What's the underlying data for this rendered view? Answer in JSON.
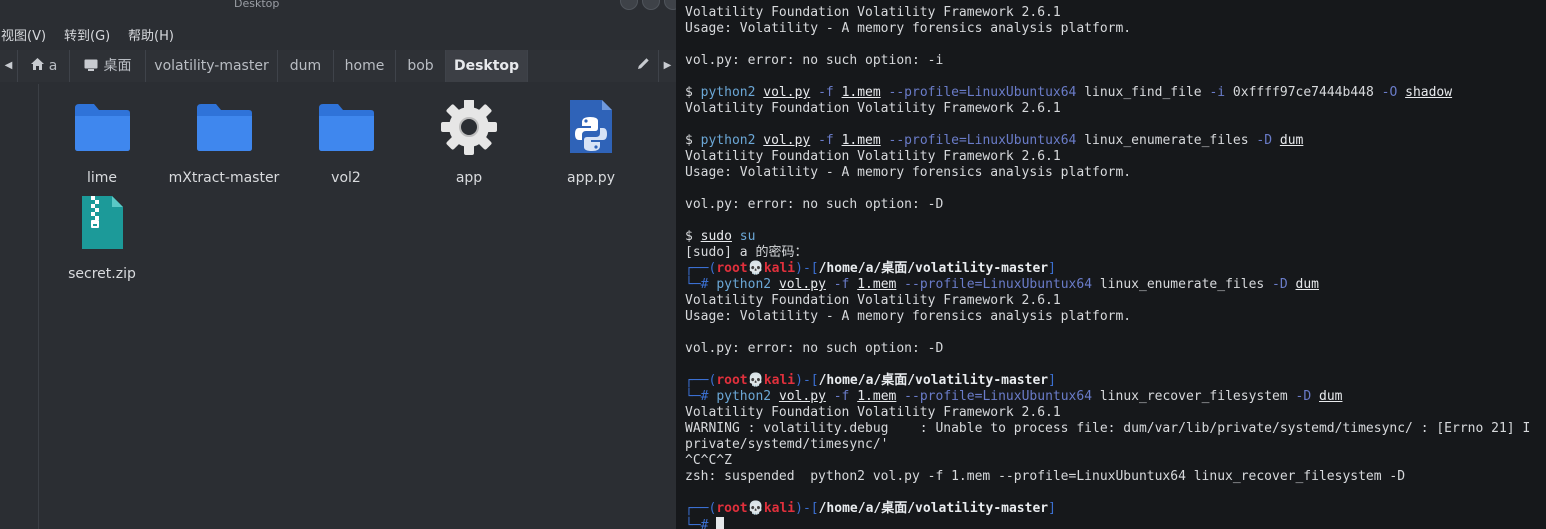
{
  "file_manager": {
    "title": "Desktop",
    "menu": [
      "视图(V)",
      "转到(G)",
      "帮助(H)"
    ],
    "breadcrumbs": [
      "a",
      "桌面",
      "volatility-master",
      "dum",
      "home",
      "bob",
      "Desktop"
    ],
    "files": [
      {
        "name": "lime",
        "icon": "folder-icon"
      },
      {
        "name": "mXtract-master",
        "icon": "folder-icon"
      },
      {
        "name": "vol2",
        "icon": "folder-icon"
      },
      {
        "name": "app",
        "icon": "gear-icon"
      },
      {
        "name": "app.py",
        "icon": "python-file-icon"
      },
      {
        "name": "secret.zip",
        "icon": "zip-file-icon"
      }
    ]
  },
  "terminal": {
    "lines": [
      {
        "kind": "plain",
        "text": "Volatility Foundation Volatility Framework 2.6.1"
      },
      {
        "kind": "plain",
        "text": "Usage: Volatility - A memory forensics analysis platform."
      },
      {
        "kind": "blank",
        "text": ""
      },
      {
        "kind": "plain",
        "text": "vol.py: error: no such option: -i"
      },
      {
        "kind": "blank",
        "text": ""
      },
      {
        "kind": "cmd",
        "prefix": "$ ",
        "segments": [
          {
            "t": "python2 ",
            "c": "cmd"
          },
          {
            "t": "vol.py",
            "c": "ul"
          },
          {
            "t": " -f ",
            "c": "opt"
          },
          {
            "t": "1.mem",
            "c": "ul"
          },
          {
            "t": " --profile=LinuxUbuntux64",
            "c": "opt"
          },
          {
            "t": " linux_find_file ",
            "c": "plain"
          },
          {
            "t": "-i",
            "c": "opt"
          },
          {
            "t": " 0xffff97ce7444b448 ",
            "c": "plain"
          },
          {
            "t": "-O",
            "c": "opt"
          },
          {
            "t": " ",
            "c": "plain"
          },
          {
            "t": "shadow",
            "c": "ul"
          }
        ]
      },
      {
        "kind": "plain",
        "text": "Volatility Foundation Volatility Framework 2.6.1"
      },
      {
        "kind": "blank",
        "text": ""
      },
      {
        "kind": "cmd",
        "prefix": "$ ",
        "segments": [
          {
            "t": "python2 ",
            "c": "cmd"
          },
          {
            "t": "vol.py",
            "c": "ul"
          },
          {
            "t": " -f ",
            "c": "opt"
          },
          {
            "t": "1.mem",
            "c": "ul"
          },
          {
            "t": " --profile=LinuxUbuntux64",
            "c": "opt"
          },
          {
            "t": " linux_enumerate_files ",
            "c": "plain"
          },
          {
            "t": "-D",
            "c": "opt"
          },
          {
            "t": " ",
            "c": "plain"
          },
          {
            "t": "dum",
            "c": "ul"
          }
        ]
      },
      {
        "kind": "plain",
        "text": "Volatility Foundation Volatility Framework 2.6.1"
      },
      {
        "kind": "plain",
        "text": "Usage: Volatility - A memory forensics analysis platform."
      },
      {
        "kind": "blank",
        "text": ""
      },
      {
        "kind": "plain",
        "text": "vol.py: error: no such option: -D"
      },
      {
        "kind": "blank",
        "text": ""
      },
      {
        "kind": "cmd",
        "prefix": "$ ",
        "segments": [
          {
            "t": "sudo",
            "c": "ul"
          },
          {
            "t": " su",
            "c": "cmd"
          }
        ]
      },
      {
        "kind": "plain",
        "text": "[sudo] a 的密码："
      },
      {
        "kind": "prompt",
        "user": "root",
        "host": "kali",
        "path": "/home/a/桌面/volatility-master"
      },
      {
        "kind": "rootcmd",
        "segments": [
          {
            "t": "python2 ",
            "c": "cmd"
          },
          {
            "t": "vol.py",
            "c": "ul"
          },
          {
            "t": " -f ",
            "c": "opt"
          },
          {
            "t": "1.mem",
            "c": "ul"
          },
          {
            "t": " --profile=LinuxUbuntux64",
            "c": "opt"
          },
          {
            "t": " linux_enumerate_files ",
            "c": "plain"
          },
          {
            "t": "-D",
            "c": "opt"
          },
          {
            "t": " ",
            "c": "plain"
          },
          {
            "t": "dum",
            "c": "ul"
          }
        ]
      },
      {
        "kind": "plain",
        "text": "Volatility Foundation Volatility Framework 2.6.1"
      },
      {
        "kind": "plain",
        "text": "Usage: Volatility - A memory forensics analysis platform."
      },
      {
        "kind": "blank",
        "text": ""
      },
      {
        "kind": "plain",
        "text": "vol.py: error: no such option: -D"
      },
      {
        "kind": "blank",
        "text": ""
      },
      {
        "kind": "prompt",
        "user": "root",
        "host": "kali",
        "path": "/home/a/桌面/volatility-master"
      },
      {
        "kind": "rootcmd",
        "segments": [
          {
            "t": "python2 ",
            "c": "cmd"
          },
          {
            "t": "vol.py",
            "c": "ul"
          },
          {
            "t": " -f ",
            "c": "opt"
          },
          {
            "t": "1.mem",
            "c": "ul"
          },
          {
            "t": " --profile=LinuxUbuntux64",
            "c": "opt"
          },
          {
            "t": " linux_recover_filesystem ",
            "c": "plain"
          },
          {
            "t": "-D",
            "c": "opt"
          },
          {
            "t": " ",
            "c": "plain"
          },
          {
            "t": "dum",
            "c": "ul"
          }
        ]
      },
      {
        "kind": "plain",
        "text": "Volatility Foundation Volatility Framework 2.6.1"
      },
      {
        "kind": "plain",
        "text": "WARNING : volatility.debug    : Unable to process file: dum/var/lib/private/systemd/timesync/ : [Errno 21] I"
      },
      {
        "kind": "plain",
        "text": "private/systemd/timesync/'"
      },
      {
        "kind": "plain",
        "text": "^C^C^Z"
      },
      {
        "kind": "plain",
        "text": "zsh: suspended  python2 vol.py -f 1.mem --profile=LinuxUbuntux64 linux_recover_filesystem -D"
      },
      {
        "kind": "blank",
        "text": ""
      },
      {
        "kind": "prompt",
        "user": "root",
        "host": "kali",
        "path": "/home/a/桌面/volatility-master"
      },
      {
        "kind": "cursor"
      }
    ]
  }
}
